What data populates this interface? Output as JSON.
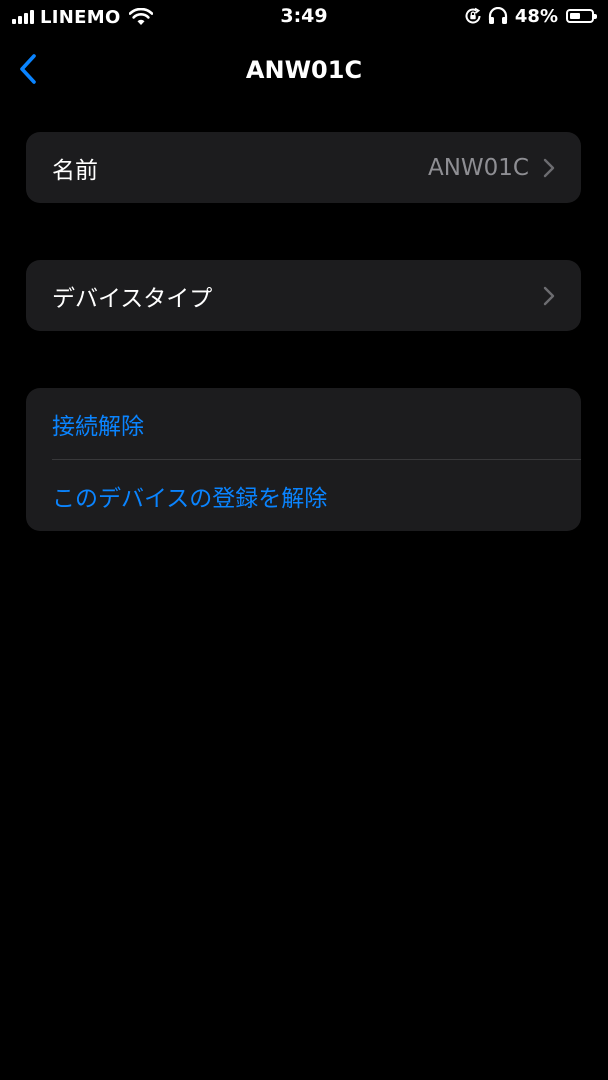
{
  "status_bar": {
    "carrier": "LINEMO",
    "time": "3:49",
    "battery_percent": "48%",
    "battery_level": 0.48,
    "icons": [
      "signal-icon",
      "wifi-icon",
      "rotation-lock-icon",
      "headphones-icon",
      "battery-icon"
    ]
  },
  "nav": {
    "back_icon": "chevron-left-icon",
    "title": "ANW01C"
  },
  "settings": {
    "name_row": {
      "label": "名前",
      "value": "ANW01C"
    },
    "device_type_row": {
      "label": "デバイスタイプ"
    },
    "actions": [
      {
        "label": "接続解除"
      },
      {
        "label": "このデバイスの登録を解除"
      }
    ]
  },
  "colors": {
    "background": "#000000",
    "cell": "#1c1c1e",
    "accent": "#0a84ff",
    "secondary_text": "#8e8e93",
    "separator": "#38383a"
  }
}
